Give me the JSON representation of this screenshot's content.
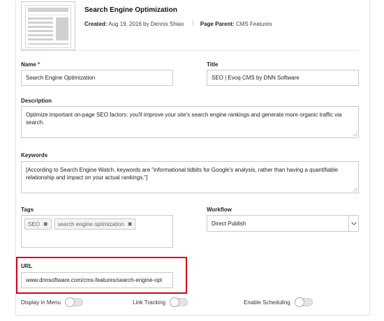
{
  "page": {
    "title": "Search Engine Optimization",
    "created_label": "Created:",
    "created_value": "Aug 19, 2016 by Dennis Shiao",
    "parent_label": "Page Parent:",
    "parent_value": "CMS Features"
  },
  "form": {
    "name": {
      "label": "Name",
      "required_mark": "*",
      "value": "Search Engine Optimization"
    },
    "title": {
      "label": "Title",
      "value": "SEO | Evoq CMS by DNN Software"
    },
    "description": {
      "label": "Description",
      "value": "Optimize important on-page SEO factors: you'll improve your site's search engine rankings and generate more organic traffic via search."
    },
    "keywords": {
      "label": "Keywords",
      "value": "[According to Search Engine Watch, keywords are \"informational tidbits for Google's analysis, rather than having a quantifiable relationship and impact on your actual rankings.\"]"
    },
    "tags": {
      "label": "Tags",
      "items": [
        "SEO",
        "search engine optimization"
      ],
      "remove_glyph": "✖"
    },
    "workflow": {
      "label": "Workflow",
      "selected": "Direct Publish"
    },
    "url": {
      "label": "URL",
      "value": "www.dnnsoftware.com/cms-features/search-engine-opt"
    },
    "toggles": [
      {
        "label": "Display in Menu",
        "on": false
      },
      {
        "label": "Link Tracking",
        "on": false
      },
      {
        "label": "Enable Scheduling",
        "on": false
      }
    ]
  },
  "colors": {
    "highlight": "#d0021b",
    "required": "#d0021b"
  },
  "icons": {
    "thumbnail": "page-thumbnail-icon",
    "select_arrow": "chevron-down-icon",
    "tag_remove": "close-icon",
    "resize": "resize-grip-icon"
  }
}
